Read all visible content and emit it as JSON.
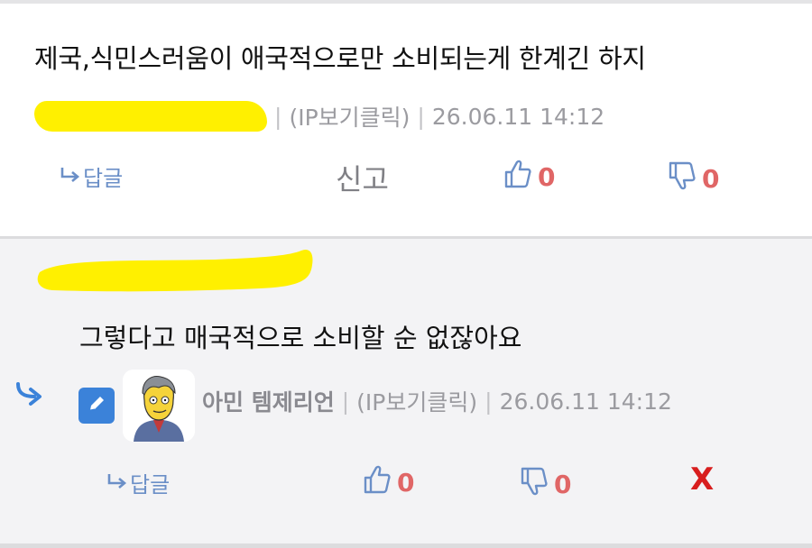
{
  "comment": {
    "body": "제국,식민스러움이 애국적으로만 소비되는게 한계긴 하지",
    "ip_label": "(IP보기클릭)",
    "timestamp": "26.06.11 14:12",
    "reply_label": "답글",
    "report_label": "신고",
    "like_count": "0",
    "dislike_count": "0"
  },
  "reply": {
    "body": "그렇다고 매국적으로 소비할 순 없잖아요",
    "author": "아민 템제리언",
    "ip_label": "(IP보기클릭)",
    "timestamp": "26.06.11 14:12",
    "reply_label": "답글",
    "like_count": "0",
    "dislike_count": "0",
    "delete_label": "X"
  },
  "separator": "|",
  "colors": {
    "accent_blue": "#6b8fc7",
    "count_red": "#e06666",
    "delete_red": "#d81e1e",
    "censor_yellow": "#fff000"
  },
  "icons": [
    "reply-arrow-icon",
    "thumbs-up-icon",
    "thumbs-down-icon",
    "thread-reply-arrow-icon",
    "pencil-icon",
    "avatar-image"
  ]
}
